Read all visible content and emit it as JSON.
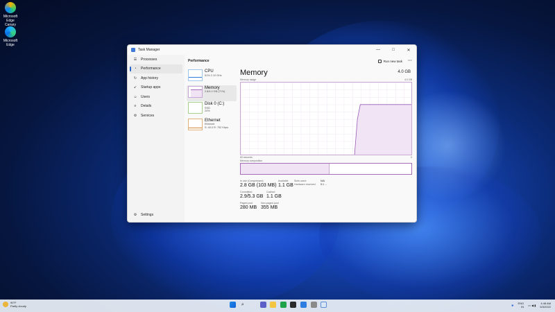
{
  "desktop": {
    "icons": [
      {
        "label": "Microsoft Edge Canary",
        "icon": "edge-canary-icon"
      },
      {
        "label": "Microsoft Edge",
        "icon": "edge-icon"
      }
    ]
  },
  "window": {
    "title": "Task Manager",
    "controls": {
      "minimize": "—",
      "maximize": "□",
      "close": "✕"
    }
  },
  "sidebar": {
    "items": [
      {
        "label": "Processes",
        "icon": "☰"
      },
      {
        "label": "Performance",
        "icon": "◔"
      },
      {
        "label": "App history",
        "icon": "↻"
      },
      {
        "label": "Startup apps",
        "icon": "➹"
      },
      {
        "label": "Users",
        "icon": "☺"
      },
      {
        "label": "Details",
        "icon": "≡"
      },
      {
        "label": "Services",
        "icon": "⚙"
      }
    ],
    "settings": {
      "label": "Settings",
      "icon": "⚙"
    }
  },
  "header": {
    "title": "Performance",
    "run_new_task": "Run new task",
    "more": "···"
  },
  "perf_list": [
    {
      "name": "CPU",
      "sub": "51% 2.10 GHz"
    },
    {
      "name": "Memory",
      "sub": "2.8/4.0 GB (71%)"
    },
    {
      "name": "Disk 0 (C:)",
      "sub": "SSD",
      "sub2": "24%"
    },
    {
      "name": "Ethernet",
      "sub": "Ethernet",
      "sub2": "S: 40.0 R: 752 Kbps"
    }
  ],
  "memory": {
    "title": "Memory",
    "total": "4.0 GB",
    "usage_label": "Memory usage",
    "usage_max": "4.0 GB",
    "graph_left": "60 seconds",
    "graph_right": "0",
    "composition_label": "Memory composition",
    "composition_used_fraction": 0.52,
    "usage_history": [
      0,
      0,
      0,
      0,
      0,
      0,
      0,
      0,
      0,
      0,
      0,
      0,
      0,
      0,
      0,
      0,
      0,
      0,
      0,
      0,
      0,
      0,
      0,
      0,
      0,
      0,
      0,
      0,
      0,
      0,
      0,
      0,
      0,
      0,
      0,
      0,
      0,
      0,
      0,
      0,
      2.0,
      2.8,
      2.8,
      2.8,
      2.8,
      2.8,
      2.8,
      2.8,
      2.8,
      2.8,
      2.8,
      2.8,
      2.8,
      2.8,
      2.8,
      2.8,
      2.8,
      2.8,
      2.8,
      2.8
    ],
    "usage_ylim": [
      0,
      4.0
    ],
    "stats": {
      "in_use_label": "In use (Compressed)",
      "in_use": "2.8 GB (103 MB)",
      "available_label": "Available",
      "available": "1.1 GB",
      "slots_label": "Slots used:",
      "slots": "N/A",
      "hw_reserved_label": "Hardware reserved:",
      "hw_reserved": "5.1 ...",
      "committed_label": "Committed",
      "committed": "2.9/5.3 GB",
      "cached_label": "Cached",
      "cached": "1.1 GB",
      "paged_label": "Paged pool",
      "paged": "280 MB",
      "nonpaged_label": "Non-paged pool",
      "nonpaged": "355 MB"
    }
  },
  "taskbar": {
    "weather_temp": "90°F",
    "weather_desc": "Partly cloudy",
    "lang": "ENG",
    "region": "IN",
    "time": "4:48 AM",
    "date": "5/3/2022"
  }
}
